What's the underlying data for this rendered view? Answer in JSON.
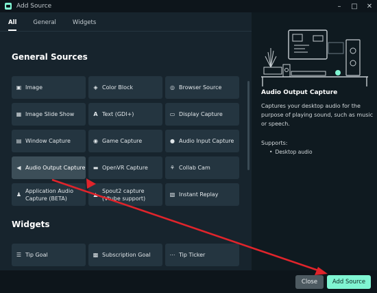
{
  "window": {
    "title": "Add Source",
    "controls": [
      "minimize-icon",
      "maximize-icon",
      "close-icon"
    ]
  },
  "tabs": [
    {
      "label": "All",
      "active": true
    },
    {
      "label": "General",
      "active": false
    },
    {
      "label": "Widgets",
      "active": false
    }
  ],
  "sections": {
    "general": "General Sources",
    "widgets": "Widgets"
  },
  "general_sources": [
    {
      "label": "Image",
      "icon": "image-icon"
    },
    {
      "label": "Color Block",
      "icon": "paint-bucket-icon"
    },
    {
      "label": "Browser Source",
      "icon": "globe-icon"
    },
    {
      "label": "Image Slide Show",
      "icon": "images-icon"
    },
    {
      "label": "Text (GDI+)",
      "icon": "text-icon"
    },
    {
      "label": "Display Capture",
      "icon": "monitor-icon"
    },
    {
      "label": "Window Capture",
      "icon": "window-icon"
    },
    {
      "label": "Game Capture",
      "icon": "gamepad-icon"
    },
    {
      "label": "Audio Input Capture",
      "icon": "microphone-icon"
    },
    {
      "label": "Audio Output Capture",
      "icon": "speaker-icon",
      "selected": true
    },
    {
      "label": "OpenVR Capture",
      "icon": "vr-headset-icon"
    },
    {
      "label": "Collab Cam",
      "icon": "collab-cam-icon"
    },
    {
      "label": "Application Audio\nCapture (BETA)",
      "icon": "user-icon"
    },
    {
      "label": "Spout2 capture\n(Vtube support)",
      "icon": "spout-icon"
    },
    {
      "label": "Instant Replay",
      "icon": "replay-icon"
    }
  ],
  "widgets": [
    {
      "label": "Tip Goal",
      "icon": "list-icon"
    },
    {
      "label": "Subscription Goal",
      "icon": "calendar-icon"
    },
    {
      "label": "Tip Ticker",
      "icon": "dots-icon"
    }
  ],
  "details": {
    "title": "Audio Output Capture",
    "description": "Captures your desktop audio for the purpose of playing sound, such as music or speech.",
    "supports_label": "Supports:",
    "supports": [
      "Desktop audio"
    ]
  },
  "footer": {
    "close_label": "Close",
    "add_label": "Add Source"
  },
  "colors": {
    "accent": "#80f5d2",
    "background": "#17242d",
    "card": "#243540",
    "arrow": "#e0242b"
  }
}
